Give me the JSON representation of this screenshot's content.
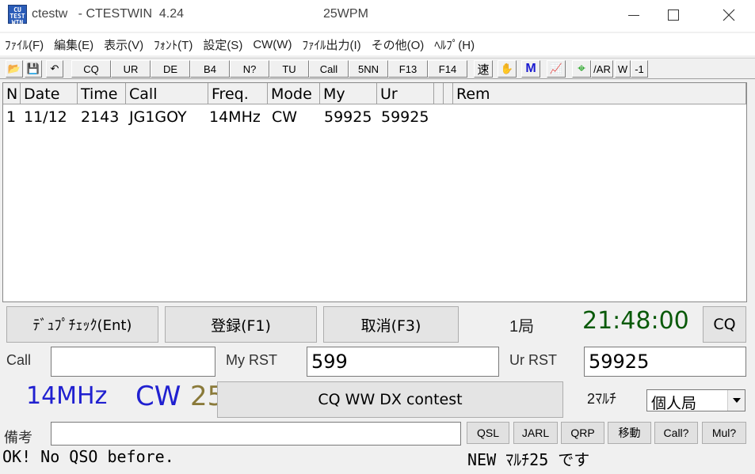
{
  "titlebar": {
    "icon_text": [
      "CU",
      "TEST",
      "WIN"
    ],
    "title": "ctestw   - CTESTWIN  4.24",
    "wpm": "25WPM"
  },
  "menu": [
    "ﾌｧｲﾙ(F)",
    "編集(E)",
    "表示(V)",
    "ﾌｫﾝﾄ(T)",
    "設定(S)",
    "CW(W)",
    "ﾌｧｲﾙ出力(I)",
    "その他(O)",
    "ﾍﾙﾌﾟ(H)"
  ],
  "toolbar": {
    "open_icon": "📂",
    "save_icon": "💾",
    "undo_icon": "↶",
    "buttons": [
      "CQ",
      "UR",
      "DE",
      "B4",
      "N?",
      "TU",
      "Call",
      "5NN",
      "F13",
      "F14"
    ],
    "speed": "速",
    "hand_icon": "✋",
    "m_label": "M",
    "graph_icon": "📈",
    "target_icon": "⌖",
    "ar_label": "/AR",
    "w_label": "W",
    "minus1_label": "-1"
  },
  "log": {
    "columns": [
      "N",
      "Date",
      "Time",
      "Call",
      "Freq.",
      "Mode",
      "My",
      "Ur",
      "",
      "",
      "Rem"
    ],
    "rows": [
      {
        "n": "1",
        "date": "11/12",
        "time": "2143",
        "call": "JG1GOY",
        "freq": "14MHz",
        "mode": "CW",
        "my": "59925",
        "ur": "59925",
        "rem": ""
      }
    ]
  },
  "controls": {
    "dupe_check": "ﾃﾞｭﾌﾟﾁｪｯｸ(Ent)",
    "register": "登録(F1)",
    "cancel": "取消(F3)",
    "station_count": "1局",
    "clock": "21:48:00",
    "cq_button": "CQ",
    "call_label": "Call",
    "call_value": "",
    "my_rst_label": "My RST",
    "my_rst_value": "599",
    "ur_rst_label": "Ur RST",
    "ur_rst_value": "59925",
    "band": "14MHz",
    "mode": "CW",
    "mode_extra": "25",
    "contest": "CQ WW DX contest",
    "multi": "2ﾏﾙﾁ",
    "category": "個人局",
    "remarks_label": "備考",
    "remarks_value": "",
    "small_buttons": [
      "QSL",
      "JARL",
      "QRP",
      "移動",
      "Call?",
      "Mul?"
    ]
  },
  "status": {
    "left": "OK! No QSO before.",
    "right": "NEW ﾏﾙﾁ25 です"
  },
  "colors": {
    "band_mode": "#2020d0",
    "clock": "#0a5a0a",
    "mode_extra": "#8a7a3a"
  }
}
